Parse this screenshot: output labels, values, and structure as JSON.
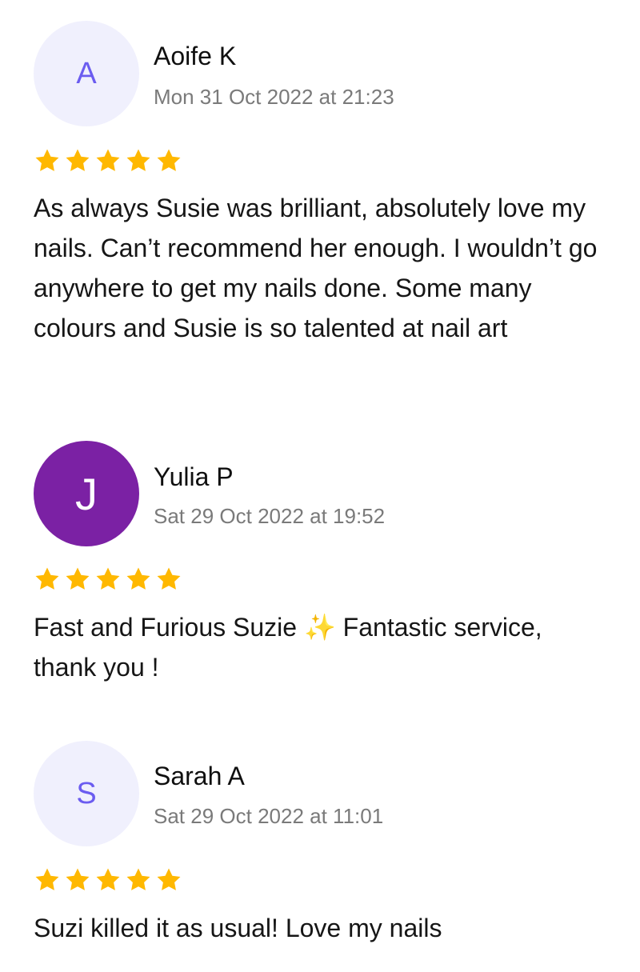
{
  "colors": {
    "star": "#ffb800",
    "avatar_light_bg": "#f0f0fd",
    "avatar_light_fg": "#6b5cf0",
    "avatar_dark_bg": "#7b21a4",
    "date_text": "#7a7a7a"
  },
  "reviews": [
    {
      "initial": "A",
      "name": "Aoife K",
      "date": "Mon 31 Oct 2022 at 21:23",
      "rating": 5,
      "text": "As always Susie was brilliant, absolutely love my nails. Can’t recommend her enough. I wouldn’t go anywhere to get my nails done. Some many colours and Susie is so talented at nail art"
    },
    {
      "initial": "J",
      "name": "Yulia P",
      "date": "Sat 29 Oct 2022 at 19:52",
      "rating": 5,
      "text": "Fast and Furious Suzie ✨ Fantastic service, thank you !"
    },
    {
      "initial": "S",
      "name": "Sarah A",
      "date": "Sat 29 Oct 2022 at 11:01",
      "rating": 5,
      "text": "Suzi killed it as usual! Love my nails"
    }
  ]
}
